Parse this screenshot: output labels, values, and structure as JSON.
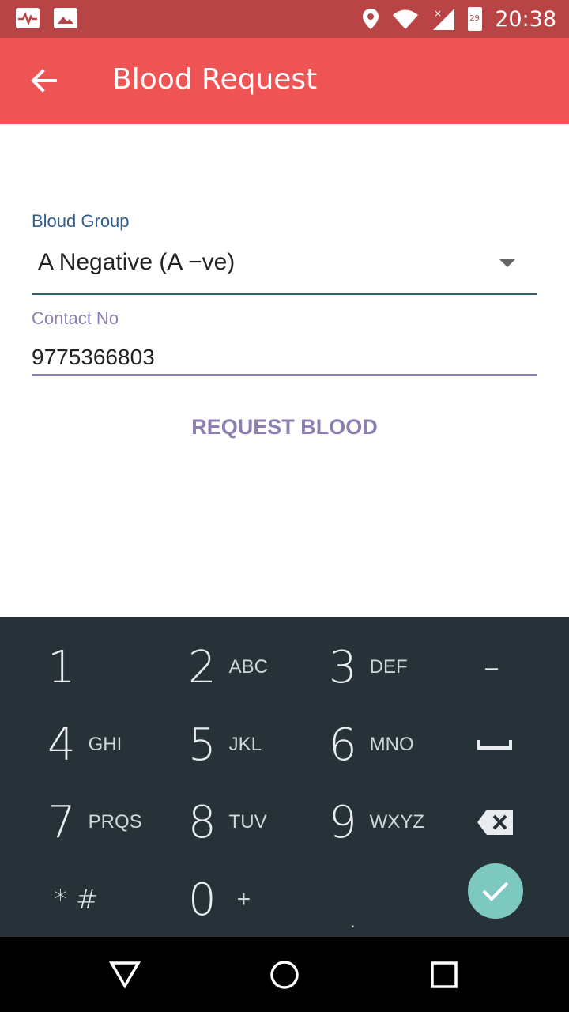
{
  "status_bar": {
    "time": "20:38",
    "battery_level": "29",
    "icons": [
      "activity-icon",
      "image-icon",
      "location-icon",
      "wifi-icon",
      "signal-icon",
      "battery-icon"
    ]
  },
  "app_bar": {
    "title": "Blood Request",
    "back_icon": "arrow-back-icon",
    "color": "#ef5455"
  },
  "form": {
    "blood_group": {
      "label": "Bloud Group",
      "selected": "A Negative (A −ve)"
    },
    "contact": {
      "label": "Contact No",
      "value": "9775366803"
    },
    "submit_label": "REQUEST BLOOD"
  },
  "keypad": {
    "keys": [
      {
        "num": "1",
        "letters": ""
      },
      {
        "num": "2",
        "letters": "ABC"
      },
      {
        "num": "3",
        "letters": "DEF"
      },
      {
        "num": "–",
        "letters": ""
      },
      {
        "num": "4",
        "letters": "GHI"
      },
      {
        "num": "5",
        "letters": "JKL"
      },
      {
        "num": "6",
        "letters": "MNO"
      },
      {
        "num": "",
        "letters": ""
      },
      {
        "num": "7",
        "letters": "PRQS"
      },
      {
        "num": "8",
        "letters": "TUV"
      },
      {
        "num": "9",
        "letters": "WXYZ"
      },
      {
        "num": "",
        "letters": ""
      },
      {
        "num": "* #",
        "letters": ""
      },
      {
        "num": "0",
        "letters": "+"
      },
      {
        "num": ".",
        "letters": ""
      }
    ],
    "background": "#263238",
    "accent": "#7ec9bf"
  },
  "nav_bar": {
    "icons": [
      "back-triangle-icon",
      "home-circle-icon",
      "recents-square-icon"
    ]
  }
}
